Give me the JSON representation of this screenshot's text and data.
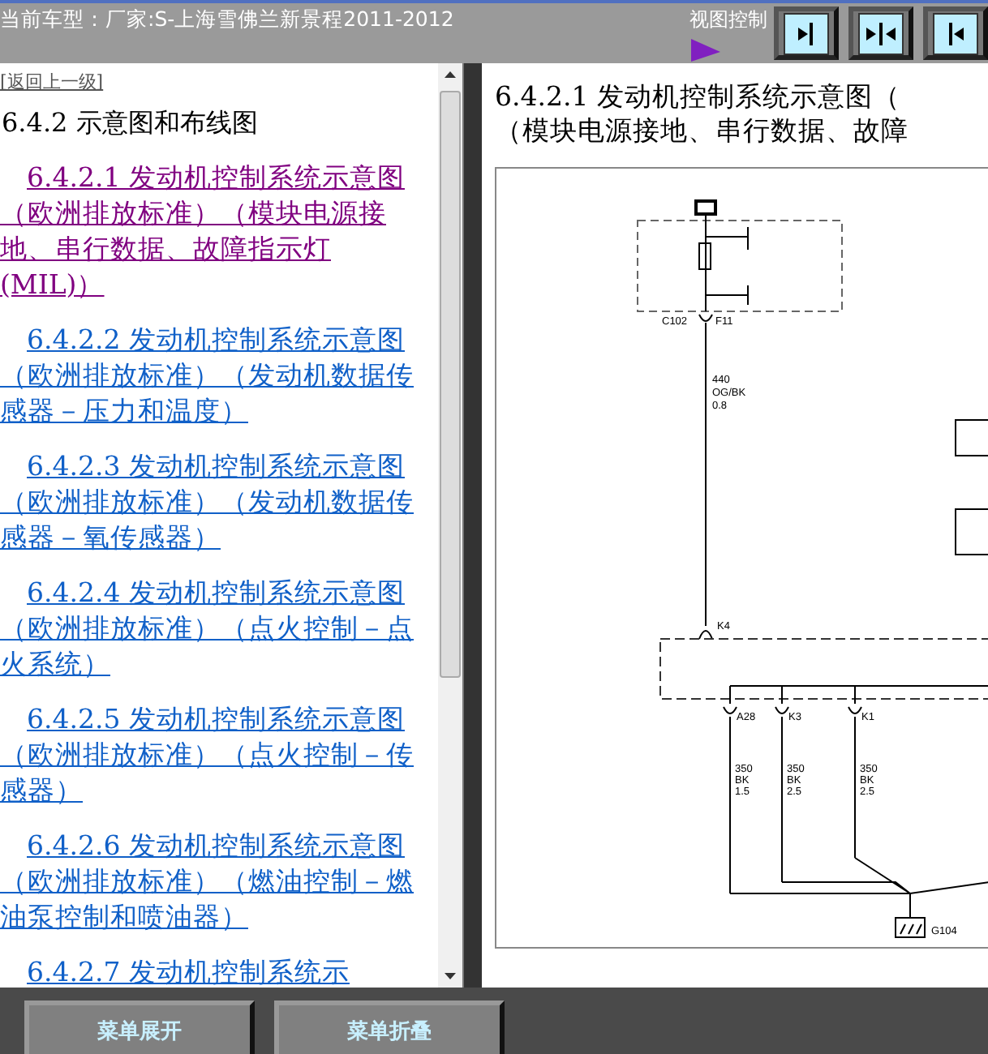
{
  "header": {
    "vehicle": "当前车型：厂家:S-上海雪佛兰新景程2011-2012",
    "view_control_label": "视图控制",
    "view_buttons": [
      {
        "kind": "expand-right"
      },
      {
        "kind": "split"
      },
      {
        "kind": "expand-left"
      }
    ]
  },
  "left_panel": {
    "back_link": "[返回上一级]",
    "heading": "6.4.2 示意图和布线图",
    "items": [
      {
        "label": "6.4.2.1 发动机控制系统示意图（欧洲排放标准）（模块电源接地、串行数据、故障指示灯(MIL)）",
        "visited": true
      },
      {
        "label": "6.4.2.2 发动机控制系统示意图（欧洲排放标准）（发动机数据传感器－压力和温度）",
        "visited": false
      },
      {
        "label": "6.4.2.3 发动机控制系统示意图（欧洲排放标准）（发动机数据传感器－氧传感器）",
        "visited": false
      },
      {
        "label": "6.4.2.4 发动机控制系统示意图（欧洲排放标准）（点火控制－点火系统）",
        "visited": false
      },
      {
        "label": "6.4.2.5 发动机控制系统示意图（欧洲排放标准）（点火控制－传感器）",
        "visited": false
      },
      {
        "label": "6.4.2.6 发动机控制系统示意图（欧洲排放标准）（燃油控制－燃油泵控制和喷油器）",
        "visited": false
      },
      {
        "label": "6.4.2.7 发动机控制系统示",
        "visited": false
      }
    ]
  },
  "right_panel": {
    "title_lines": [
      "6.4.2.1 发动机控制系统示意图（",
      "（模块电源接地、串行数据、故障"
    ],
    "diagram": {
      "top_connector": "C102",
      "top_pin": "F11",
      "main_wire": [
        "440",
        "OG/BK",
        "0.8"
      ],
      "bottom_pin": "K4",
      "pins": [
        {
          "pin": "A28",
          "wire": [
            "350",
            "BK",
            "1.5"
          ]
        },
        {
          "pin": "K3",
          "wire": [
            "350",
            "BK",
            "2.5"
          ]
        },
        {
          "pin": "K1",
          "wire": [
            "350",
            "BK",
            "2.5"
          ]
        }
      ],
      "ground": "G104"
    }
  },
  "footer": {
    "buttons": [
      "菜单展开",
      "菜单折叠"
    ]
  }
}
